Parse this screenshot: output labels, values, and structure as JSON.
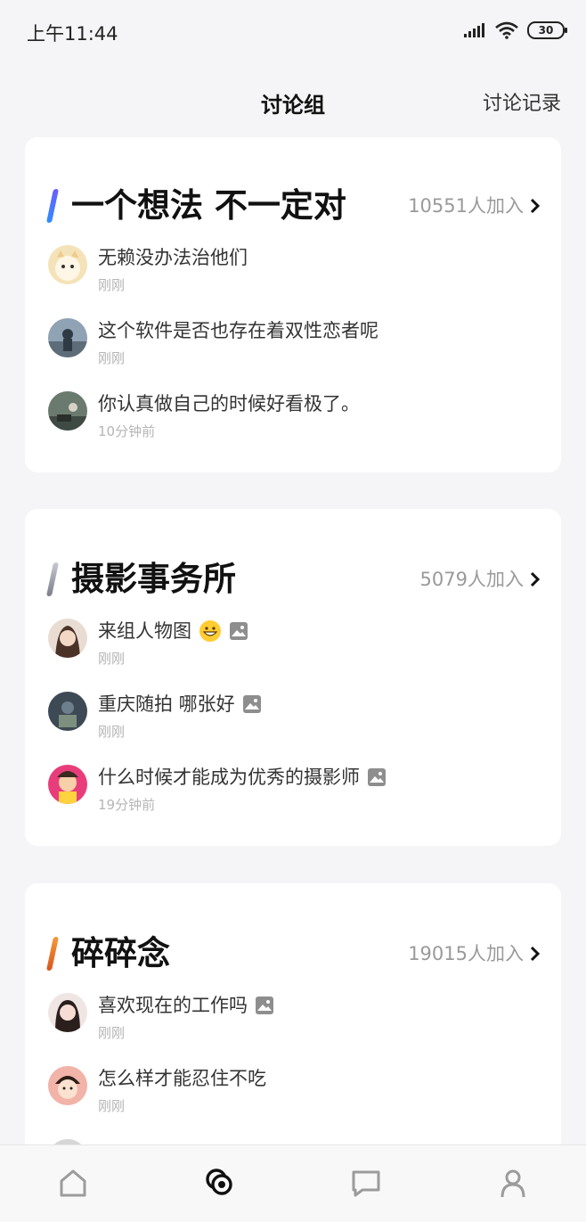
{
  "status": {
    "time": "上午11:44",
    "battery": "30"
  },
  "nav": {
    "title": "讨论组",
    "right_link": "讨论记录"
  },
  "groups": [
    {
      "title": "一个想法 不一定对",
      "joined": "10551人加入",
      "accent": "#3b5bff",
      "posts": [
        {
          "title": "无赖没办法治他们",
          "time": "刚刚",
          "has_image": false
        },
        {
          "title": "这个软件是否也存在着双性恋者呢",
          "time": "刚刚",
          "has_image": false
        },
        {
          "title": "你认真做自己的时候好看极了。",
          "time": "10分钟前",
          "has_image": false
        }
      ]
    },
    {
      "title": "摄影事务所",
      "joined": "5079人加入",
      "accent": "#9a9aa8",
      "posts": [
        {
          "title": "来组人物图",
          "time": "刚刚",
          "has_image": true,
          "emoji": "grinning-emoji"
        },
        {
          "title": "重庆随拍 哪张好",
          "time": "刚刚",
          "has_image": true
        },
        {
          "title": "什么时候才能成为优秀的摄影师",
          "time": "19分钟前",
          "has_image": true
        }
      ]
    },
    {
      "title": "碎碎念",
      "joined": "19015人加入",
      "accent": "#e8762b",
      "posts": [
        {
          "title": "喜欢现在的工作吗",
          "time": "刚刚",
          "has_image": true
        },
        {
          "title": "怎么样才能忍住不吃",
          "time": "刚刚",
          "has_image": false
        }
      ]
    }
  ],
  "tabs": [
    {
      "icon": "home-icon",
      "active": false
    },
    {
      "icon": "discussion-icon",
      "active": true
    },
    {
      "icon": "message-icon",
      "active": false
    },
    {
      "icon": "profile-icon",
      "active": false
    }
  ]
}
